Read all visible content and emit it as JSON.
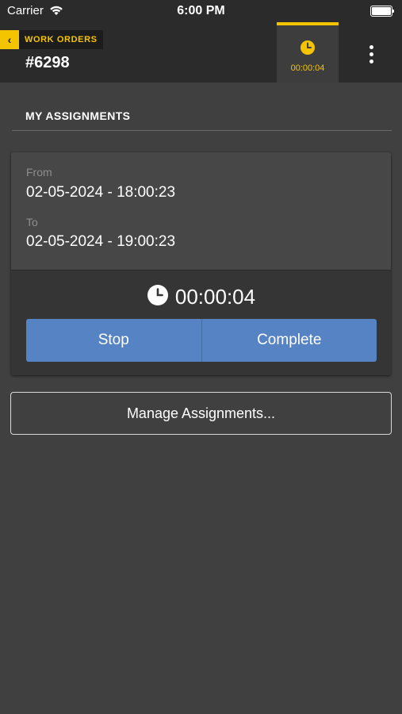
{
  "status_bar": {
    "carrier": "Carrier",
    "time": "6:00 PM"
  },
  "header": {
    "back_label": "WORK ORDERS",
    "back_arrow": "‹",
    "title": "#6298",
    "timer_label": "00:00:04"
  },
  "section": {
    "title": "MY ASSIGNMENTS"
  },
  "assignment": {
    "from_label": "From",
    "from_value": "02-05-2024 - 18:00:23",
    "to_label": "To",
    "to_value": "02-05-2024 - 19:00:23",
    "elapsed": "00:00:04",
    "stop_label": "Stop",
    "complete_label": "Complete"
  },
  "manage_label": "Manage Assignments...",
  "colors": {
    "accent": "#f5c400",
    "button_blue": "#5583c3",
    "background": "#404040",
    "header": "#2b2b2b"
  }
}
